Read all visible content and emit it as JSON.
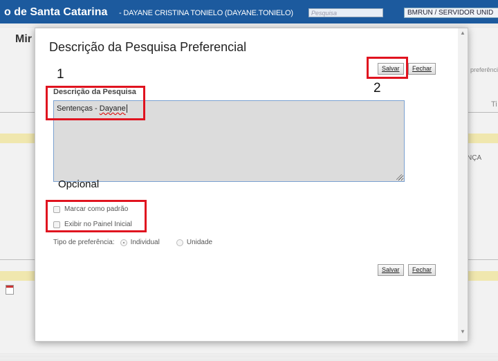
{
  "topbar": {
    "org": "o de Santa Catarina",
    "user": "- DAYANE CRISTINA TONIELO (DAYANE.TONIELO)",
    "search_placeholder": "Pesquisa",
    "unit": "BMRUN / SERVIDOR UNID"
  },
  "background": {
    "heading": "Mir",
    "text_preferencia": "preferênci",
    "text_ti": "Ti",
    "text_nca": "NÇA"
  },
  "modal": {
    "title": "Descrição da Pesquisa Preferencial",
    "save_label": "Salvar",
    "close_label": "Fechar",
    "field_label": "Descrição da Pesquisa",
    "field_value_prefix": "Sentenças - ",
    "field_value_name": "Dayane",
    "checkbox_default": "Marcar como padrão",
    "checkbox_panel": "Exibir no Painel Inicial",
    "pref_type_label": "Tipo de preferência:",
    "radio_individual": "Individual",
    "radio_unidade": "Unidade"
  },
  "annotations": {
    "one": "1",
    "two": "2",
    "optional": "Opcional",
    "box_color": "#e0131f"
  }
}
